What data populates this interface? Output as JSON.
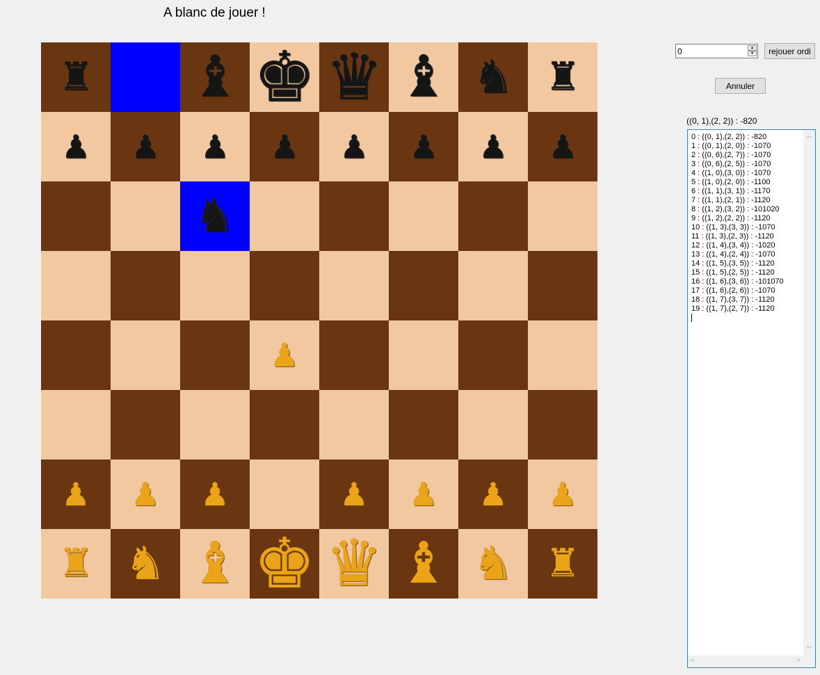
{
  "status": "A blanc de jouer !",
  "board": {
    "light_color": "#f2c8a0",
    "dark_color": "#6a3511",
    "highlight_color": "#0000ff",
    "highlighted": [
      "0,1",
      "2,2"
    ],
    "rows": [
      [
        "bR",
        "",
        "bB",
        "bK",
        "bQ",
        "bB",
        "bN",
        "bR"
      ],
      [
        "bP",
        "bP",
        "bP",
        "bP",
        "bP",
        "bP",
        "bP",
        "bP"
      ],
      [
        "",
        "",
        "bN",
        "",
        "",
        "",
        "",
        ""
      ],
      [
        "",
        "",
        "",
        "",
        "",
        "",
        "",
        ""
      ],
      [
        "",
        "",
        "",
        "wP",
        "",
        "",
        "",
        ""
      ],
      [
        "",
        "",
        "",
        "",
        "",
        "",
        "",
        ""
      ],
      [
        "wP",
        "wP",
        "wP",
        "",
        "wP",
        "wP",
        "wP",
        "wP"
      ],
      [
        "wR",
        "wN",
        "wB",
        "wK",
        "wQ",
        "wB",
        "wN",
        "wR"
      ]
    ]
  },
  "controls": {
    "spin_value": "0",
    "replay_button": "rejouer ordi",
    "undo_button": "Annuler"
  },
  "best_move": "((0, 1),(2, 2)) : -820",
  "moves": [
    "0 : ((0, 1),(2, 2)) : -820",
    "1 : ((0, 1),(2, 0)) : -1070",
    "2 : ((0, 6),(2, 7)) : -1070",
    "3 : ((0, 6),(2, 5)) : -1070",
    "4 : ((1, 0),(3, 0)) : -1070",
    "5 : ((1, 0),(2, 0)) : -1100",
    "6 : ((1, 1),(3, 1)) : -1170",
    "7 : ((1, 1),(2, 1)) : -1120",
    "8 : ((1, 2),(3, 2)) : -101020",
    "9 : ((1, 2),(2, 2)) : -1120",
    "10 : ((1, 3),(3, 3)) : -1070",
    "11 : ((1, 3),(2, 3)) : -1120",
    "12 : ((1, 4),(3, 4)) : -1020",
    "13 : ((1, 4),(2, 4)) : -1070",
    "14 : ((1, 5),(3, 5)) : -1120",
    "15 : ((1, 5),(2, 5)) : -1120",
    "16 : ((1, 6),(3, 6)) : -101070",
    "17 : ((1, 6),(2, 6)) : -1070",
    "18 : ((1, 7),(3, 7)) : -1120",
    "19 : ((1, 7),(2, 7)) : -1120"
  ]
}
